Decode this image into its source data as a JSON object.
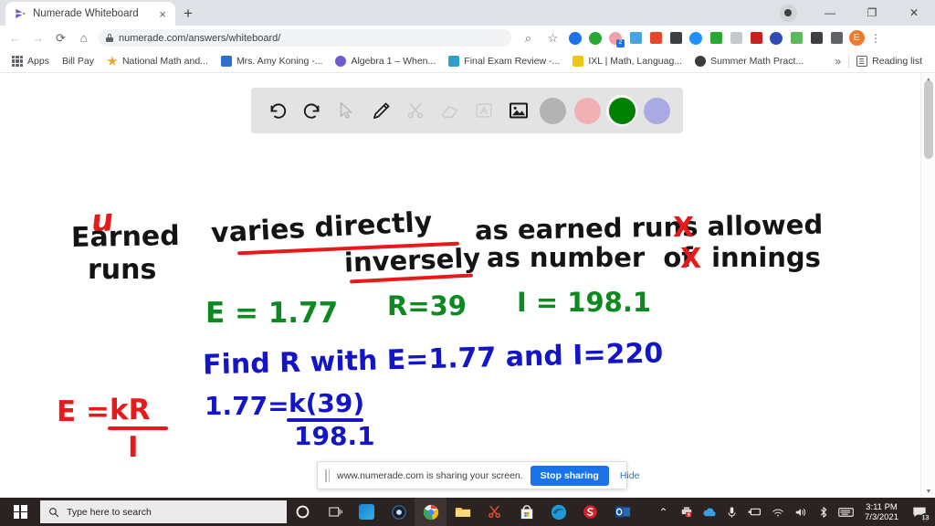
{
  "browser": {
    "tab": {
      "title": "Numerade Whiteboard",
      "favicon": "numerade-play-icon",
      "close": "×"
    },
    "new_tab_label": "+",
    "window_controls": {
      "share_indicator": "screen-share-indicator",
      "minimize": "—",
      "maximize": "❐",
      "close": "✕"
    },
    "nav": {
      "back": "←",
      "forward": "→",
      "reload": "⟳",
      "home": "⌂"
    },
    "omnibox": {
      "url": "numerade.com/answers/whiteboard/",
      "lock": "lock-icon",
      "zoom": "⌕",
      "bookmark_star": "☆"
    },
    "extensions": [
      {
        "name": "extension-compass",
        "color": "#1a73e8",
        "shape": "circle"
      },
      {
        "name": "extension-plus-green",
        "color": "#2aa836",
        "shape": "circle"
      },
      {
        "name": "extension-pink-badge",
        "color": "#f4a0a8",
        "shape": "circle",
        "badge": "2"
      },
      {
        "name": "extension-cloud-blue",
        "color": "#4aa3df",
        "shape": "square"
      },
      {
        "name": "extension-red-page",
        "color": "#e8472b",
        "shape": "square"
      },
      {
        "name": "extension-dark-grid",
        "color": "#3c4043",
        "shape": "square"
      },
      {
        "name": "extension-blue-diamond",
        "color": "#1e90ff",
        "shape": "circle"
      },
      {
        "name": "extension-cast-green",
        "color": "#2aa836",
        "shape": "square"
      },
      {
        "name": "extension-gray-faded",
        "color": "#c6c9cc",
        "shape": "square"
      },
      {
        "name": "extension-adobe-acrobat",
        "color": "#cc1f1f",
        "shape": "square"
      },
      {
        "name": "extension-kaspersky-k",
        "color": "#2f4bb5",
        "shape": "circle"
      },
      {
        "name": "extension-green-note",
        "color": "#5cb85c",
        "shape": "square"
      },
      {
        "name": "extension-puzzle-piece",
        "color": "#3c4043",
        "shape": "square"
      },
      {
        "name": "extension-cast",
        "color": "#5f6368",
        "shape": "square"
      }
    ],
    "profile_initial": "E",
    "menu": "⋮"
  },
  "bookmarks": {
    "apps_label": "Apps",
    "items": [
      {
        "label": "Bill Pay",
        "icon": "none",
        "color": ""
      },
      {
        "label": "National Math and...",
        "icon": "star-icon",
        "color": "#f5a623"
      },
      {
        "label": "Mrs. Amy Koning -...",
        "icon": "window-icon",
        "color": "#2f6fd0"
      },
      {
        "label": "Algebra 1 – When...",
        "icon": "wordpress-icon",
        "color": "#6d5bd0"
      },
      {
        "label": "Final Exam Review -...",
        "icon": "window-icon",
        "color": "#2f9fd0"
      },
      {
        "label": "IXL | Math, Languag...",
        "icon": "ixl-icon",
        "color": "#f0c419"
      },
      {
        "label": "Summer Math Pract...",
        "icon": "dark-circle-icon",
        "color": "#3c3c3c"
      }
    ],
    "overflow": "»",
    "reading_list": "Reading list"
  },
  "whiteboard": {
    "toolbar": [
      {
        "name": "undo-icon",
        "label": "Undo",
        "disabled": false
      },
      {
        "name": "redo-icon",
        "label": "Redo",
        "disabled": false
      },
      {
        "name": "cursor-icon",
        "label": "Select",
        "disabled": true
      },
      {
        "name": "pencil-icon",
        "label": "Pen",
        "disabled": false
      },
      {
        "name": "scissors-icon",
        "label": "Tools",
        "disabled": true
      },
      {
        "name": "eraser-icon",
        "label": "Eraser",
        "disabled": true
      },
      {
        "name": "text-icon",
        "label": "Text",
        "disabled": true
      },
      {
        "name": "image-icon",
        "label": "Image",
        "disabled": false
      }
    ],
    "colors": [
      {
        "name": "swatch-gray",
        "hex": "#b3b3b3",
        "selected": false
      },
      {
        "name": "swatch-pink",
        "hex": "#f1b0b4",
        "selected": false
      },
      {
        "name": "swatch-green",
        "hex": "#008000",
        "selected": true
      },
      {
        "name": "swatch-periwinkle",
        "hex": "#aaaae4",
        "selected": false
      }
    ],
    "ink": {
      "earned": "Earned",
      "runs": "runs",
      "u_correction": "u",
      "varies_directly": "varies directly",
      "as_earned_runs_allowed": "as earned runs allowed",
      "inversely": "inversely",
      "as_number_of_innings": "as number  of  innings",
      "strike_runs": "X",
      "strike_number": "X",
      "e_value": "E = 1.77",
      "r_value": "R=39",
      "i_value": "I = 198.1",
      "find_line": "Find R with E=1.77 and I=220",
      "formula_left": "E =",
      "formula_num": "kR",
      "formula_den": "I",
      "work_left": "1.77=",
      "work_num": "k(39)",
      "work_den": "198.1"
    }
  },
  "scrollbar": {
    "up": "▲",
    "down": "▼"
  },
  "share_bar": {
    "grip": "drag-grip-icon",
    "message": "www.numerade.com is sharing your screen.",
    "stop_label": "Stop sharing",
    "hide_label": "Hide"
  },
  "taskbar": {
    "start": "windows-start-icon",
    "search_placeholder": "Type here to search",
    "search_icon": "search-icon",
    "apps": [
      {
        "name": "cortana-icon",
        "color": "#ffffff"
      },
      {
        "name": "task-view-icon",
        "color": "#d8d8d8"
      },
      {
        "name": "app-blue-wave-icon",
        "color": "#1b7fd4"
      },
      {
        "name": "app-dark-circle-icon",
        "color": "#1a2b3c"
      },
      {
        "name": "google-chrome-icon",
        "color": "#4285f4",
        "active": true
      },
      {
        "name": "file-explorer-icon",
        "color": "#f7c14b"
      },
      {
        "name": "snip-and-sketch-icon",
        "color": "#e04a2f"
      },
      {
        "name": "microsoft-store-icon",
        "color": "#ffffff"
      },
      {
        "name": "microsoft-edge-icon",
        "color": "#1e9ad6"
      },
      {
        "name": "app-red-s-icon",
        "color": "#d81f2a"
      },
      {
        "name": "outlook-icon",
        "color": "#1f6bb8"
      }
    ],
    "tray": [
      {
        "name": "show-hidden-icons-chevron",
        "glyph": "⌃"
      },
      {
        "name": "printer-alert-icon",
        "glyph": ""
      },
      {
        "name": "onedrive-cloud-icon",
        "glyph": ""
      },
      {
        "name": "microphone-icon",
        "glyph": ""
      },
      {
        "name": "screen-share-icon",
        "glyph": ""
      },
      {
        "name": "wifi-icon",
        "glyph": ""
      },
      {
        "name": "volume-icon",
        "glyph": ""
      },
      {
        "name": "bluetooth-icon",
        "glyph": ""
      },
      {
        "name": "keyboard-icon",
        "glyph": ""
      }
    ],
    "clock": {
      "time": "3:11 PM",
      "date": "7/3/2021"
    },
    "notifications": {
      "name": "action-center-icon",
      "count": "13"
    }
  }
}
